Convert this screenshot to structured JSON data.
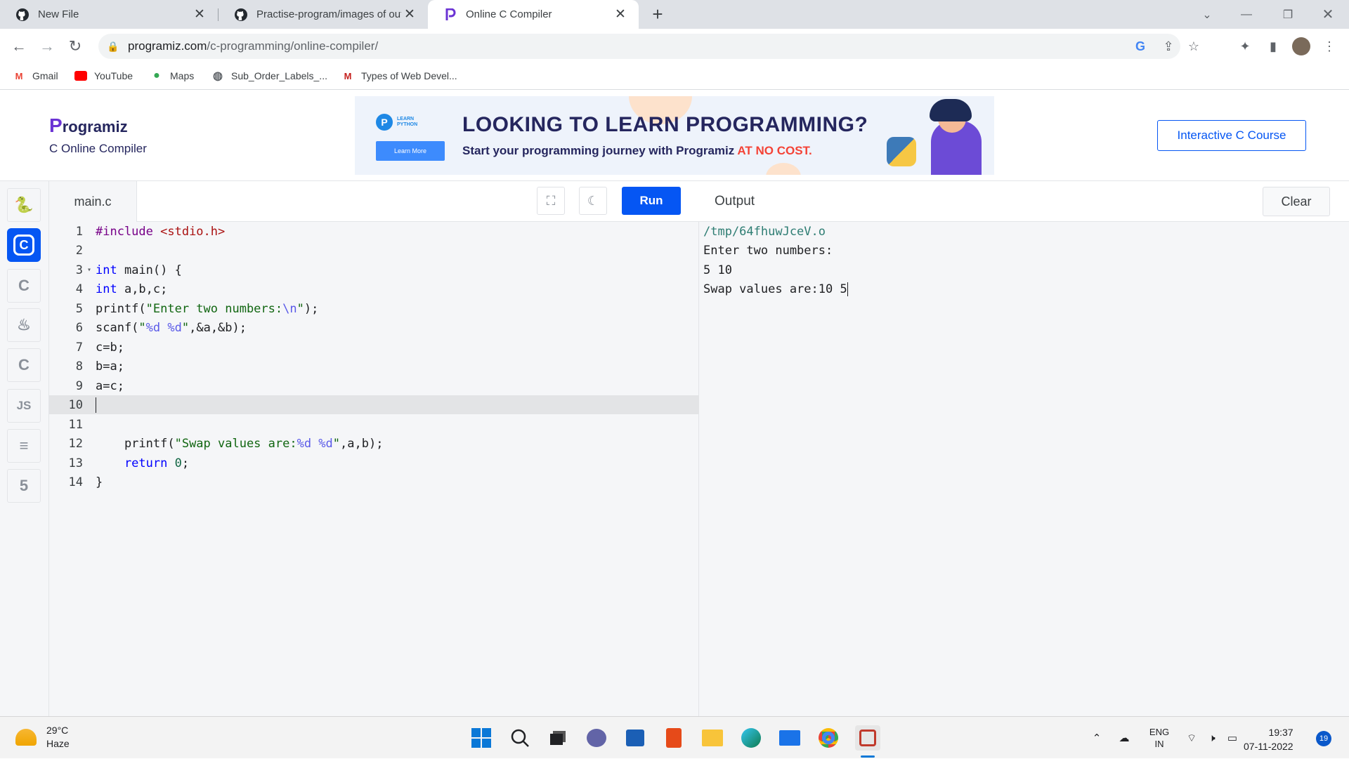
{
  "browser": {
    "tabs": [
      {
        "title": "New File",
        "icon": "github-icon"
      },
      {
        "title": "Practise-program/images of outp",
        "icon": "github-icon"
      },
      {
        "title": "Online C Compiler",
        "icon": "programiz-icon"
      }
    ],
    "url_domain": "programiz.com",
    "url_path": "/c-programming/online-compiler/",
    "bookmarks": [
      "Gmail",
      "YouTube",
      "Maps",
      "Sub_Order_Labels_...",
      "Types of Web Devel..."
    ]
  },
  "header": {
    "logo_text": "rogramiz",
    "logo_letter": "P",
    "subtitle": "C Online Compiler",
    "banner": {
      "badge_line1": "LEARN",
      "badge_line2": "PYTHON",
      "learn_more": "Learn More",
      "headline": "LOOKING TO LEARN PROGRAMMING?",
      "tagline": "Start your programming journey with Programiz ",
      "tagline_highlight": "AT NO COST."
    },
    "course_button": "Interactive C Course"
  },
  "sidebar": {
    "languages": [
      {
        "name": "python",
        "glyph": "🐍"
      },
      {
        "name": "c",
        "glyph": "C"
      },
      {
        "name": "cpp",
        "glyph": "C"
      },
      {
        "name": "java",
        "glyph": "♨"
      },
      {
        "name": "csharp",
        "glyph": "C"
      },
      {
        "name": "javascript",
        "glyph": "JS"
      },
      {
        "name": "sql",
        "glyph": "≡"
      },
      {
        "name": "html",
        "glyph": "5"
      }
    ]
  },
  "editor": {
    "filename": "main.c",
    "run_label": "Run",
    "line_numbers": [
      "1",
      "2",
      "3",
      "4",
      "5",
      "6",
      "7",
      "8",
      "9",
      "10",
      "11",
      "12",
      "13",
      "14"
    ],
    "lines": {
      "l1a": "#include",
      "l1b": " <stdio.h>",
      "l3a": "int",
      "l3b": " main() {",
      "l4a": "int",
      "l4b": " a,b,c;",
      "l5a": "printf(",
      "l5b": "\"Enter two numbers:",
      "l5c": "\\n",
      "l5d": "\"",
      "l5e": ");",
      "l6a": "scanf(",
      "l6b": "\"",
      "l6c": "%d %d",
      "l6d": "\"",
      "l6e": ",&a,&b);",
      "l7": "c=b;",
      "l8": "b=a;",
      "l9": "a=c;",
      "l12a": "    printf(",
      "l12b": "\"Swap values are:",
      "l12c": "%d %d",
      "l12d": "\"",
      "l12e": ",a,b);",
      "l13a": "    return",
      "l13b": " 0",
      "l13c": ";",
      "l14": "}"
    }
  },
  "output": {
    "title": "Output",
    "clear_label": "Clear",
    "lines": [
      "/tmp/64fhuwJceV.o",
      "Enter two numbers:",
      "5 10",
      "Swap values are:10 5"
    ]
  },
  "taskbar": {
    "temperature": "29°C",
    "weather": "Haze",
    "lang1": "ENG",
    "lang2": "IN",
    "time": "19:37",
    "date": "07-11-2022",
    "notifications": "19"
  }
}
